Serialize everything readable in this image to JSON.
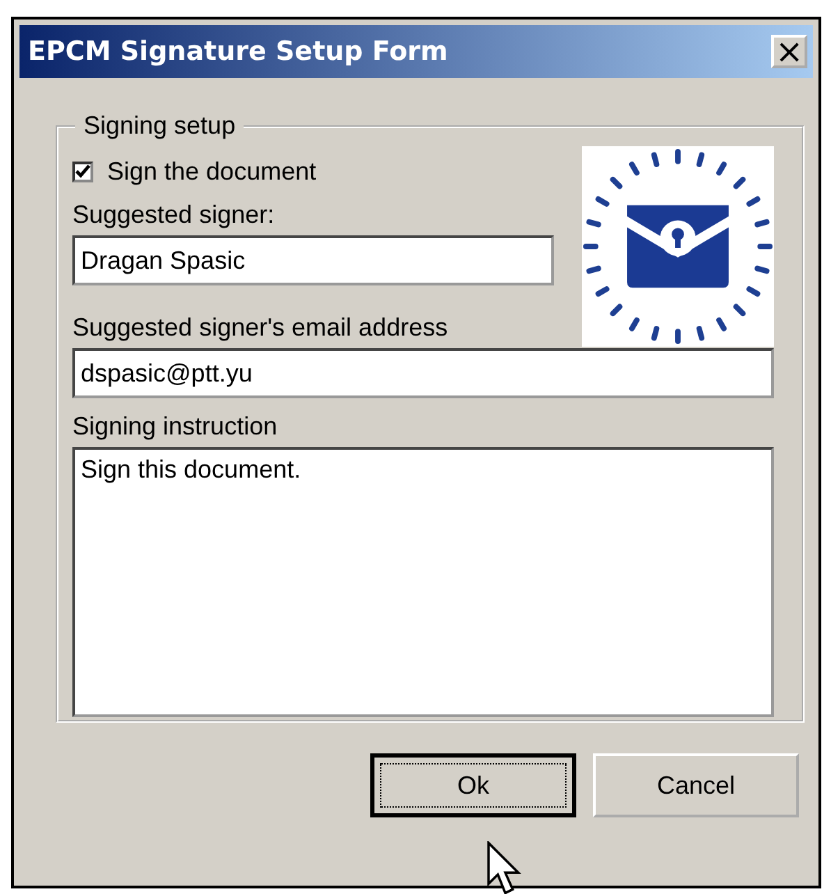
{
  "window": {
    "title": "EPCM Signature Setup Form",
    "close": "×"
  },
  "group": {
    "label": "Signing setup",
    "sign_checkbox": {
      "label": "Sign the document",
      "checked": true
    },
    "signer": {
      "label": "Suggested signer:",
      "value": "Dragan Spasic"
    },
    "email": {
      "label": "Suggested signer's email address",
      "value": "dspasic@ptt.yu"
    },
    "instruction": {
      "label": "Signing instruction",
      "value": "Sign this document."
    }
  },
  "buttons": [
    {
      "label": "Ok",
      "focused": true
    },
    {
      "label": "Cancel",
      "focused": false
    }
  ]
}
